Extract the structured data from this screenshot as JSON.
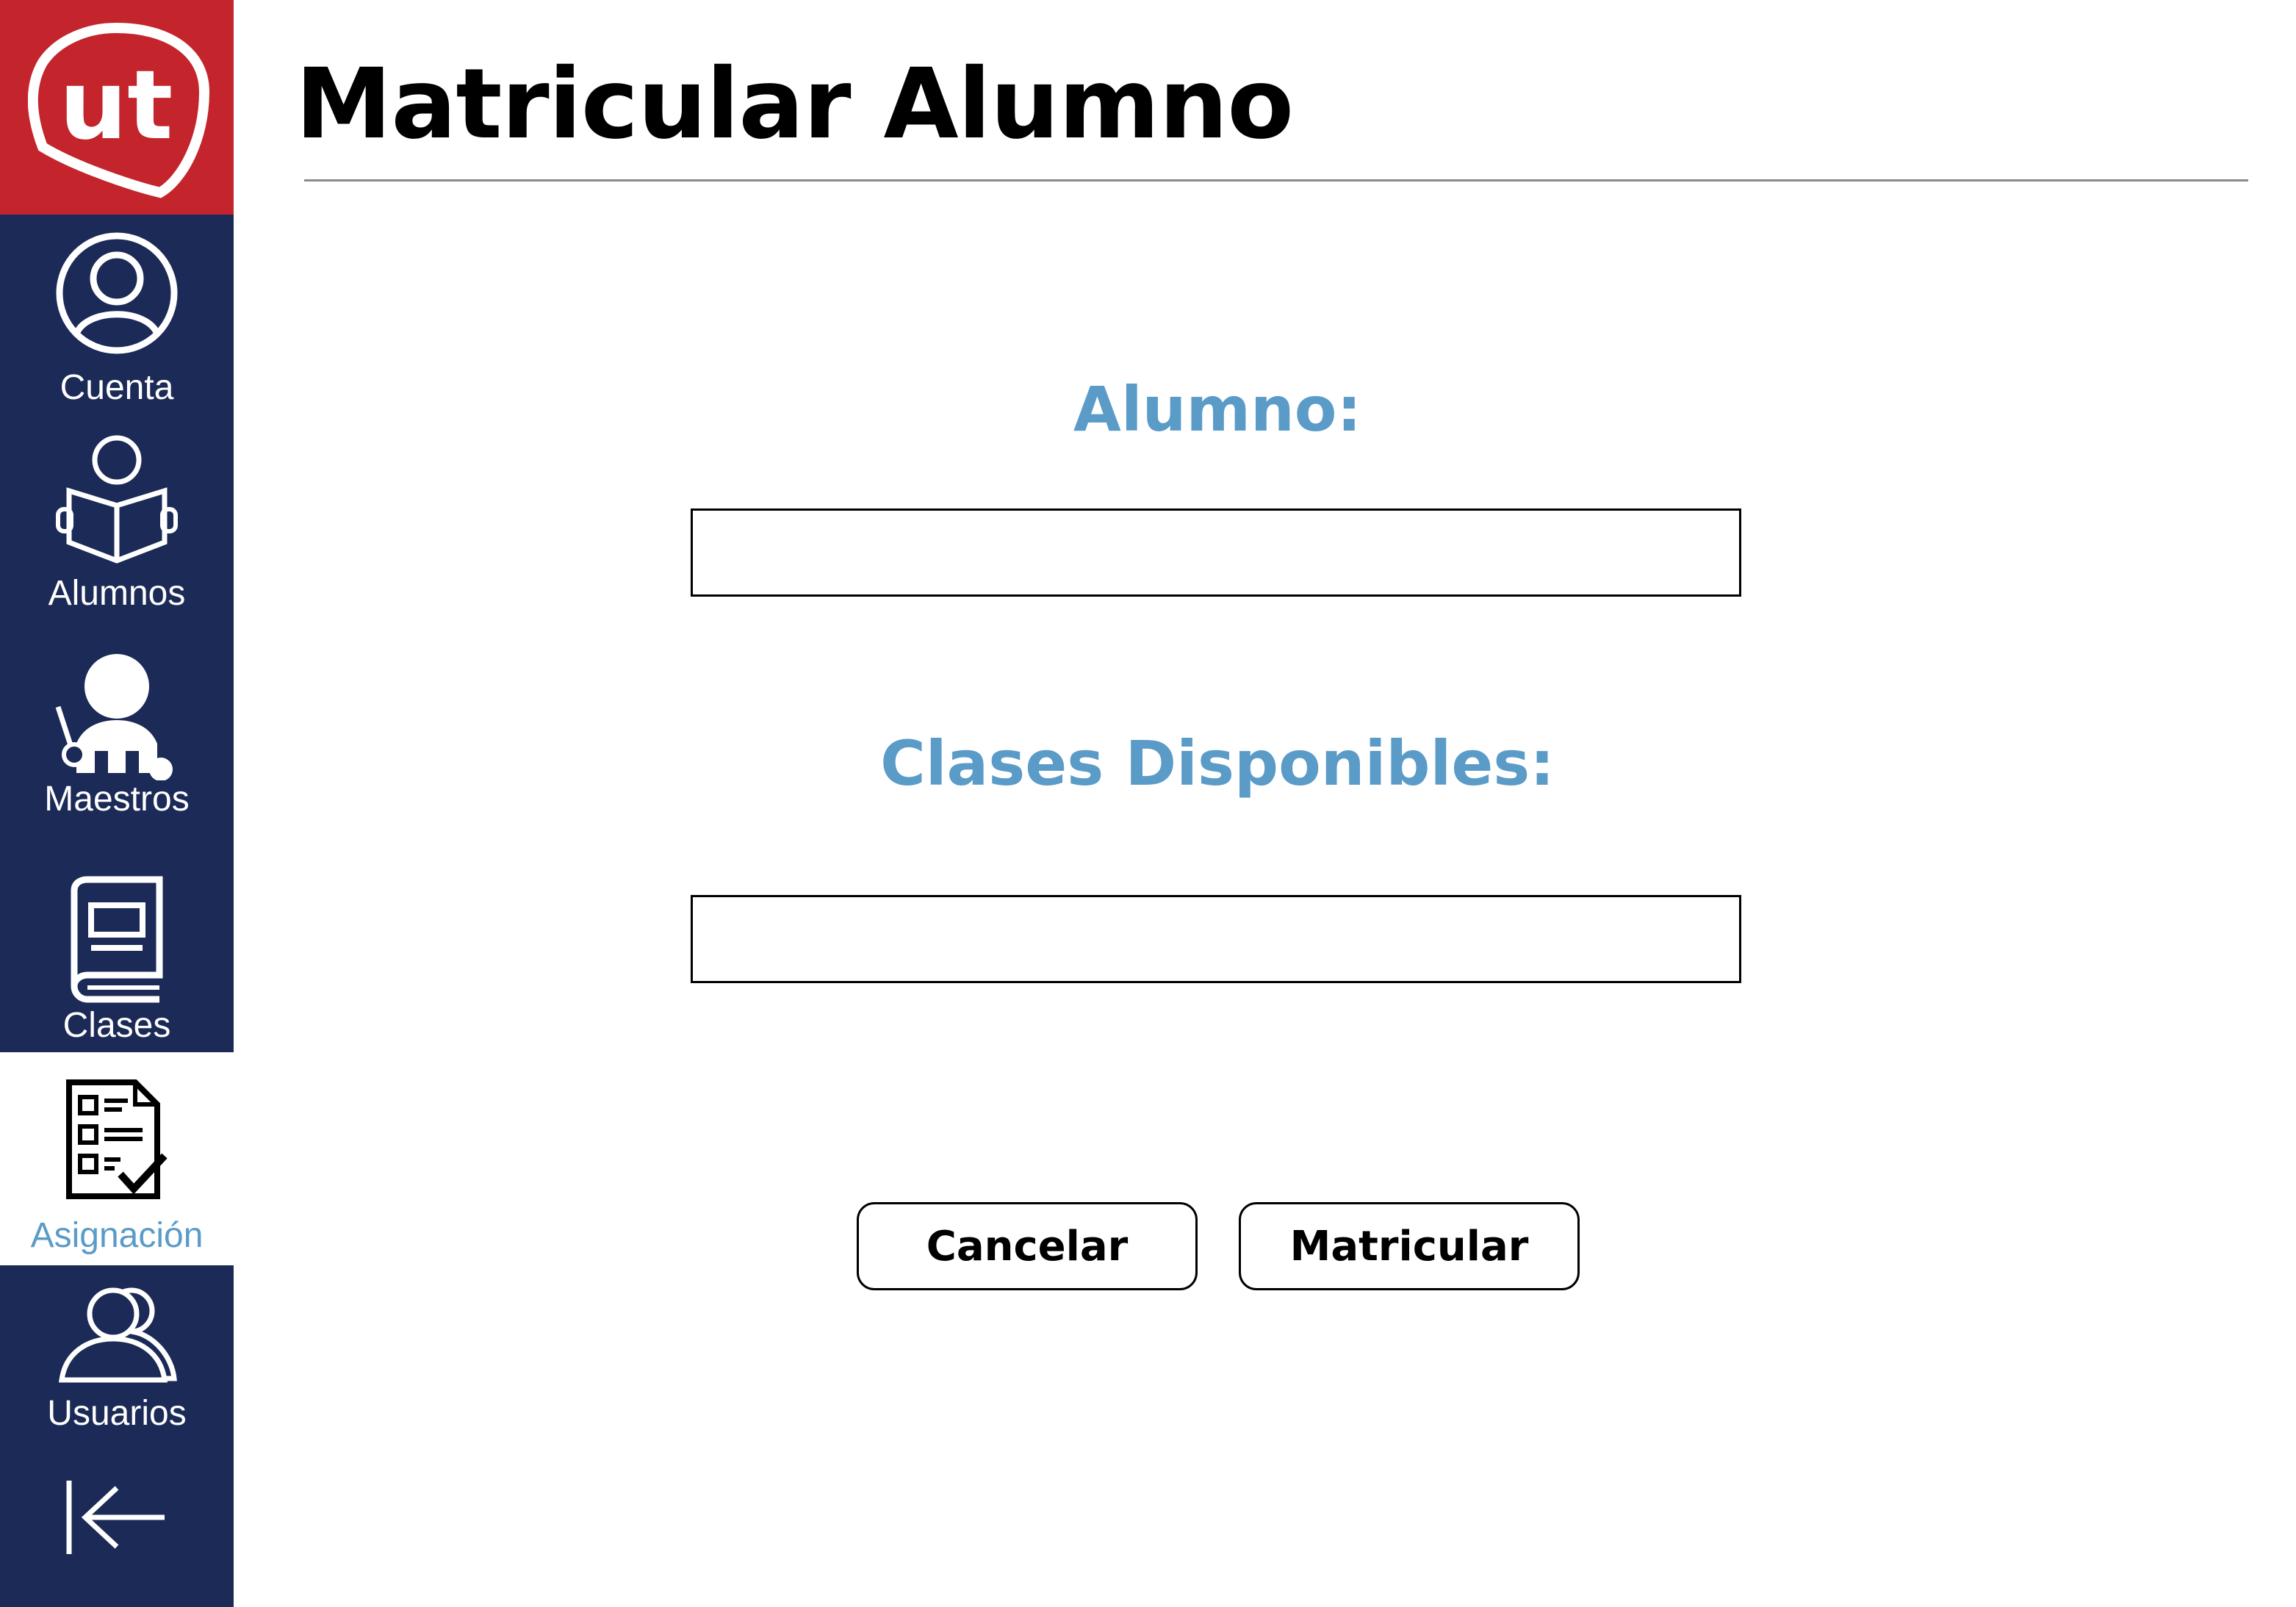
{
  "page": {
    "title": "Matricular Alumno"
  },
  "sidebar": {
    "logo_text": "ut",
    "items": [
      {
        "label": "Cuenta",
        "icon": "user-circle-icon"
      },
      {
        "label": "Alumnos",
        "icon": "student-reading-icon"
      },
      {
        "label": "Maestros",
        "icon": "teacher-icon"
      },
      {
        "label": "Clases",
        "icon": "book-icon"
      },
      {
        "label": "Asignación",
        "icon": "checklist-icon",
        "active": true
      },
      {
        "label": "Usuarios",
        "icon": "users-icon"
      }
    ],
    "logout_icon": "logout-arrow-icon"
  },
  "form": {
    "alumno_label": "Alumno:",
    "alumno_value": "",
    "clases_label": "Clases Disponibles:",
    "clases_value": ""
  },
  "buttons": {
    "cancel_label": "Cancelar",
    "submit_label": "Matricular"
  },
  "colors": {
    "sidebar_bg": "#1b2a56",
    "logo_bg": "#c4242b",
    "accent": "#5b9bc8"
  }
}
